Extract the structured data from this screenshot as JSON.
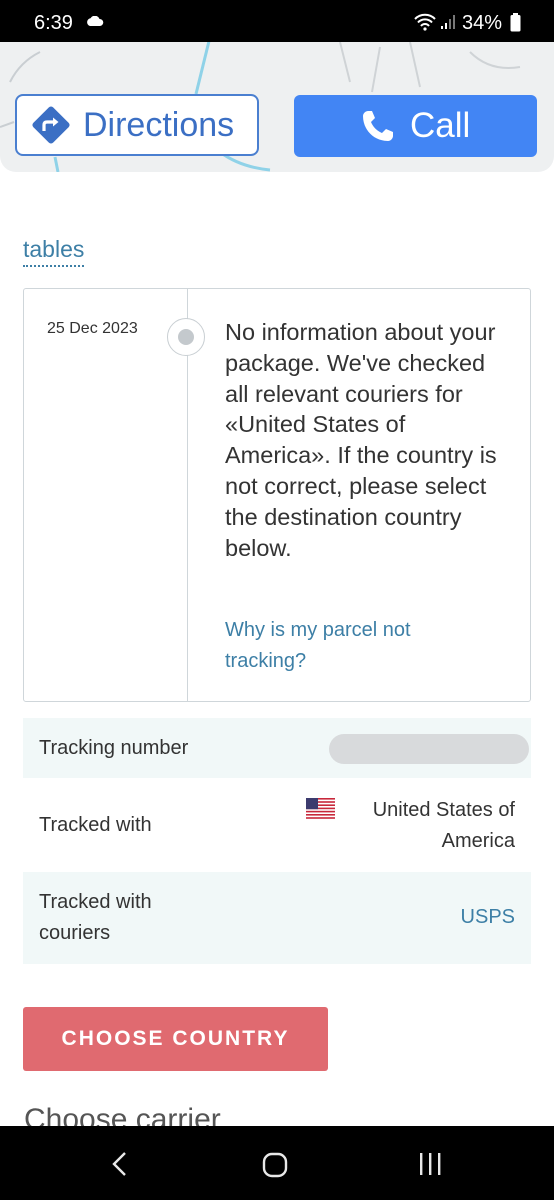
{
  "status_bar": {
    "time": "6:39",
    "battery": "34%"
  },
  "map_actions": {
    "directions_label": "Directions",
    "call_label": "Call"
  },
  "tables_link": "tables",
  "event": {
    "date": "25 Dec 2023",
    "message": "No information about your package. We've checked all relevant couriers for «United States of America». If the country is not correct, please select the destination country below.",
    "help_link": "Why is my parcel not tracking?"
  },
  "details": {
    "tracking_number_label": "Tracking number",
    "tracked_with_label": "Tracked with",
    "tracked_with_value": "United States of America",
    "couriers_label": "Tracked with couriers",
    "couriers_value": "USPS"
  },
  "choose_country_button": "CHOOSE COUNTRY",
  "carrier_heading": "Choose carrier",
  "colors": {
    "accent_blue": "#4285f4",
    "link": "#3d7fa6",
    "button_red": "#e06a70",
    "row_shade": "#f1f8f8"
  },
  "icons": [
    "cloud-icon",
    "wifi-icon",
    "signal-icon",
    "battery-icon",
    "directions-icon",
    "phone-icon",
    "us-flag-icon",
    "back-icon",
    "home-icon",
    "recents-icon"
  ]
}
